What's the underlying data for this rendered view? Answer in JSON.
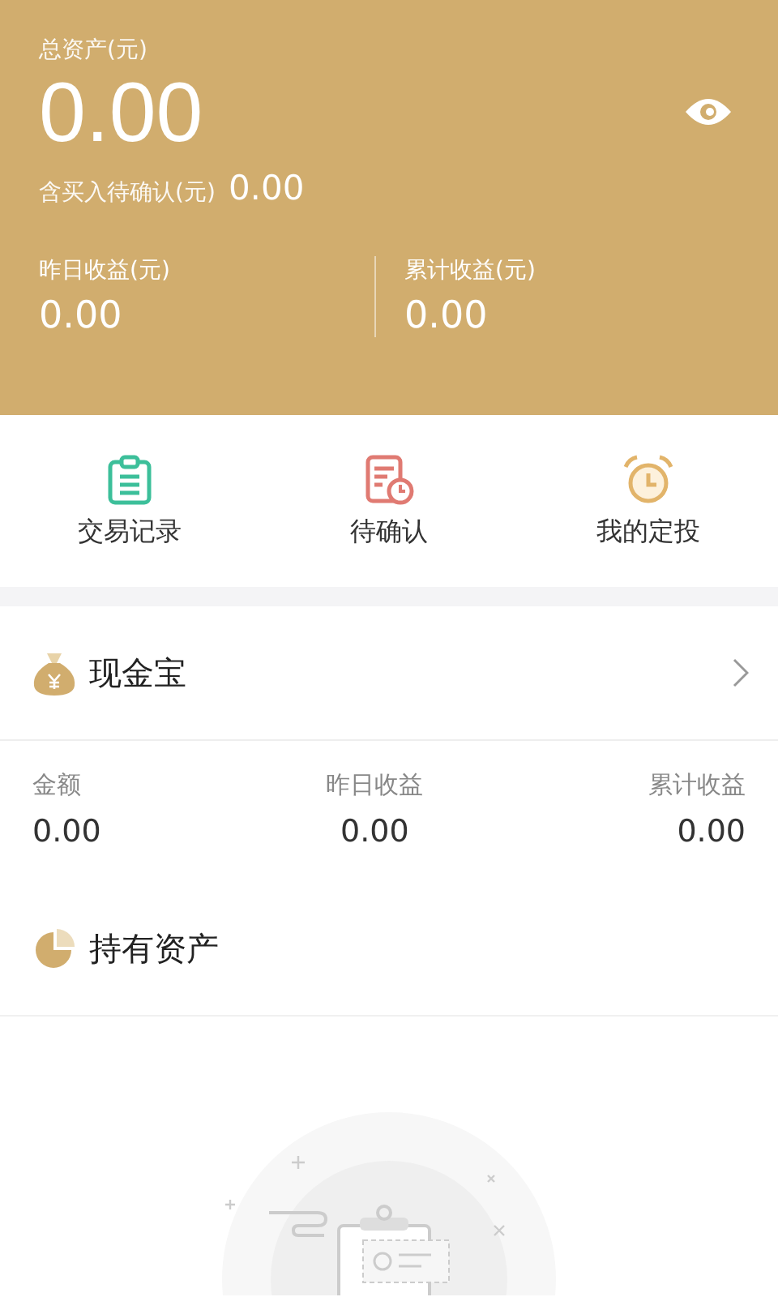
{
  "summary": {
    "total_label": "总资产(元)",
    "total_value": "0.00",
    "visible": true,
    "pending_label": "含买入待确认(元)",
    "pending_value": "0.00",
    "stats": [
      {
        "label": "昨日收益(元)",
        "value": "0.00"
      },
      {
        "label": "累计收益(元)",
        "value": "0.00"
      }
    ]
  },
  "actions": [
    {
      "label": "交易记录",
      "kind": "clipboard"
    },
    {
      "label": "待确认",
      "kind": "pending"
    },
    {
      "label": "我的定投",
      "kind": "clock"
    }
  ],
  "cash": {
    "title": "现金宝",
    "columns": [
      {
        "label": "金额",
        "value": "0.00"
      },
      {
        "label": "昨日收益",
        "value": "0.00"
      },
      {
        "label": "累计收益",
        "value": "0.00"
      }
    ]
  },
  "holdings": {
    "title": "持有资产",
    "empty": true
  }
}
